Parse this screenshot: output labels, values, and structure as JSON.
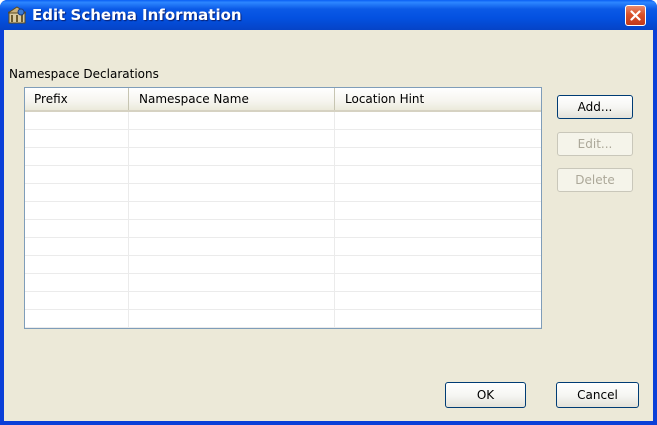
{
  "window": {
    "title": "Edit Schema Information",
    "title_icon": "schema-icon",
    "close_icon": "close-icon"
  },
  "namespace_section": {
    "label": "Namespace Declarations",
    "columns": [
      "Prefix",
      "Namespace Name",
      "Location Hint"
    ],
    "rows": [
      [
        "",
        "",
        ""
      ],
      [
        "",
        "",
        ""
      ],
      [
        "",
        "",
        ""
      ],
      [
        "",
        "",
        ""
      ],
      [
        "",
        "",
        ""
      ],
      [
        "",
        "",
        ""
      ],
      [
        "",
        "",
        ""
      ],
      [
        "",
        "",
        ""
      ],
      [
        "",
        "",
        ""
      ],
      [
        "",
        "",
        ""
      ],
      [
        "",
        "",
        ""
      ],
      [
        "",
        "",
        ""
      ]
    ]
  },
  "side_buttons": {
    "add_label": "Add...",
    "edit_label": "Edit...",
    "delete_label": "Delete"
  },
  "footer_buttons": {
    "ok_label": "OK",
    "cancel_label": "Cancel"
  },
  "colors": {
    "titlebar": "#0a5ff4",
    "dialog_background": "#ece9d8",
    "close_button": "#d9512a"
  }
}
